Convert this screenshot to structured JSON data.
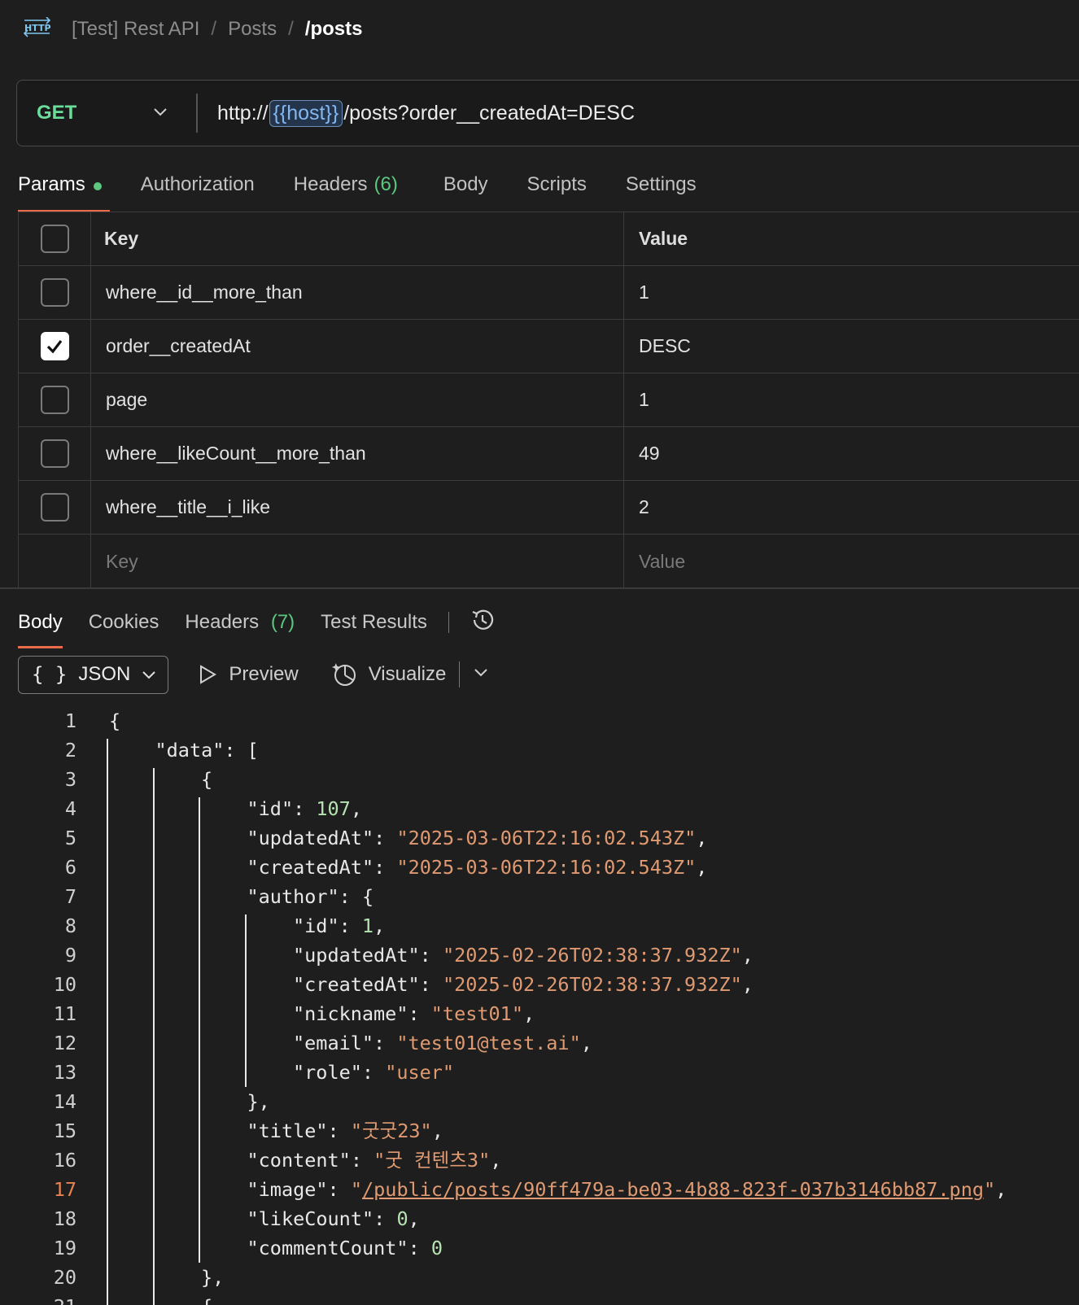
{
  "breadcrumb": {
    "icon": "http-icon",
    "items": [
      "[Test] Rest API",
      "Posts"
    ],
    "separator": "/",
    "current": "/posts"
  },
  "request": {
    "method": "GET",
    "url_prefix": "http://",
    "url_variable": "{{host}}",
    "url_suffix": "/posts?order__createdAt=DESC"
  },
  "request_tabs": {
    "params": "Params",
    "authorization": "Authorization",
    "headers": "Headers",
    "headers_count": "(6)",
    "body": "Body",
    "scripts": "Scripts",
    "settings": "Settings"
  },
  "params_table": {
    "key_header": "Key",
    "value_header": "Value",
    "rows": [
      {
        "key": "where__id__more_than",
        "value": "1",
        "checked": false
      },
      {
        "key": "order__createdAt",
        "value": "DESC",
        "checked": true
      },
      {
        "key": "page",
        "value": "1",
        "checked": false
      },
      {
        "key": "where__likeCount__more_than",
        "value": "49",
        "checked": false
      },
      {
        "key": "where__title__i_like",
        "value": "2",
        "checked": false
      }
    ],
    "key_placeholder": "Key",
    "value_placeholder": "Value"
  },
  "response_tabs": {
    "body": "Body",
    "cookies": "Cookies",
    "headers": "Headers",
    "headers_count": "(7)",
    "test_results": "Test Results"
  },
  "response_toolbar": {
    "format": "JSON",
    "braces": "{ }",
    "preview": "Preview",
    "visualize": "Visualize"
  },
  "code": {
    "current_line": 17,
    "lines": [
      {
        "n": "1",
        "indent": 0,
        "parts": [
          [
            "p",
            "{"
          ]
        ]
      },
      {
        "n": "2",
        "indent": 1,
        "parts": [
          [
            "p",
            "\"data\": ["
          ]
        ]
      },
      {
        "n": "3",
        "indent": 2,
        "parts": [
          [
            "p",
            "{"
          ]
        ]
      },
      {
        "n": "4",
        "indent": 3,
        "parts": [
          [
            "p",
            "\"id\": "
          ],
          [
            "num",
            "107"
          ],
          [
            "p",
            ","
          ]
        ]
      },
      {
        "n": "5",
        "indent": 3,
        "parts": [
          [
            "p",
            "\"updatedAt\": "
          ],
          [
            "str",
            "\"2025-03-06T22:16:02.543Z\""
          ],
          [
            "p",
            ","
          ]
        ]
      },
      {
        "n": "6",
        "indent": 3,
        "parts": [
          [
            "p",
            "\"createdAt\": "
          ],
          [
            "str",
            "\"2025-03-06T22:16:02.543Z\""
          ],
          [
            "p",
            ","
          ]
        ]
      },
      {
        "n": "7",
        "indent": 3,
        "parts": [
          [
            "p",
            "\"author\": {"
          ]
        ]
      },
      {
        "n": "8",
        "indent": 4,
        "parts": [
          [
            "p",
            "\"id\": "
          ],
          [
            "num",
            "1"
          ],
          [
            "p",
            ","
          ]
        ]
      },
      {
        "n": "9",
        "indent": 4,
        "parts": [
          [
            "p",
            "\"updatedAt\": "
          ],
          [
            "str",
            "\"2025-02-26T02:38:37.932Z\""
          ],
          [
            "p",
            ","
          ]
        ]
      },
      {
        "n": "10",
        "indent": 4,
        "parts": [
          [
            "p",
            "\"createdAt\": "
          ],
          [
            "str",
            "\"2025-02-26T02:38:37.932Z\""
          ],
          [
            "p",
            ","
          ]
        ]
      },
      {
        "n": "11",
        "indent": 4,
        "parts": [
          [
            "p",
            "\"nickname\": "
          ],
          [
            "str",
            "\"test01\""
          ],
          [
            "p",
            ","
          ]
        ]
      },
      {
        "n": "12",
        "indent": 4,
        "parts": [
          [
            "p",
            "\"email\": "
          ],
          [
            "str",
            "\"test01@test.ai\""
          ],
          [
            "p",
            ","
          ]
        ]
      },
      {
        "n": "13",
        "indent": 4,
        "parts": [
          [
            "p",
            "\"role\": "
          ],
          [
            "str",
            "\"user\""
          ]
        ]
      },
      {
        "n": "14",
        "indent": 3,
        "parts": [
          [
            "p",
            "},"
          ]
        ]
      },
      {
        "n": "15",
        "indent": 3,
        "parts": [
          [
            "p",
            "\"title\": "
          ],
          [
            "str",
            "\"굿굿23\""
          ],
          [
            "p",
            ","
          ]
        ]
      },
      {
        "n": "16",
        "indent": 3,
        "parts": [
          [
            "p",
            "\"content\": "
          ],
          [
            "str",
            "\"굿 컨텐츠3\""
          ],
          [
            "p",
            ","
          ]
        ]
      },
      {
        "n": "17",
        "indent": 3,
        "parts": [
          [
            "p",
            "\"image\": "
          ],
          [
            "str",
            "\""
          ],
          [
            "link",
            "/public/posts/90ff479a-be03-4b88-823f-037b3146bb87.png"
          ],
          [
            "str",
            "\""
          ],
          [
            "p",
            ","
          ]
        ]
      },
      {
        "n": "18",
        "indent": 3,
        "parts": [
          [
            "p",
            "\"likeCount\": "
          ],
          [
            "num",
            "0"
          ],
          [
            "p",
            ","
          ]
        ]
      },
      {
        "n": "19",
        "indent": 3,
        "parts": [
          [
            "p",
            "\"commentCount\": "
          ],
          [
            "num",
            "0"
          ]
        ]
      },
      {
        "n": "20",
        "indent": 2,
        "parts": [
          [
            "p",
            "},"
          ]
        ]
      },
      {
        "n": "21",
        "indent": 2,
        "parts": [
          [
            "p",
            "{"
          ]
        ]
      }
    ]
  }
}
